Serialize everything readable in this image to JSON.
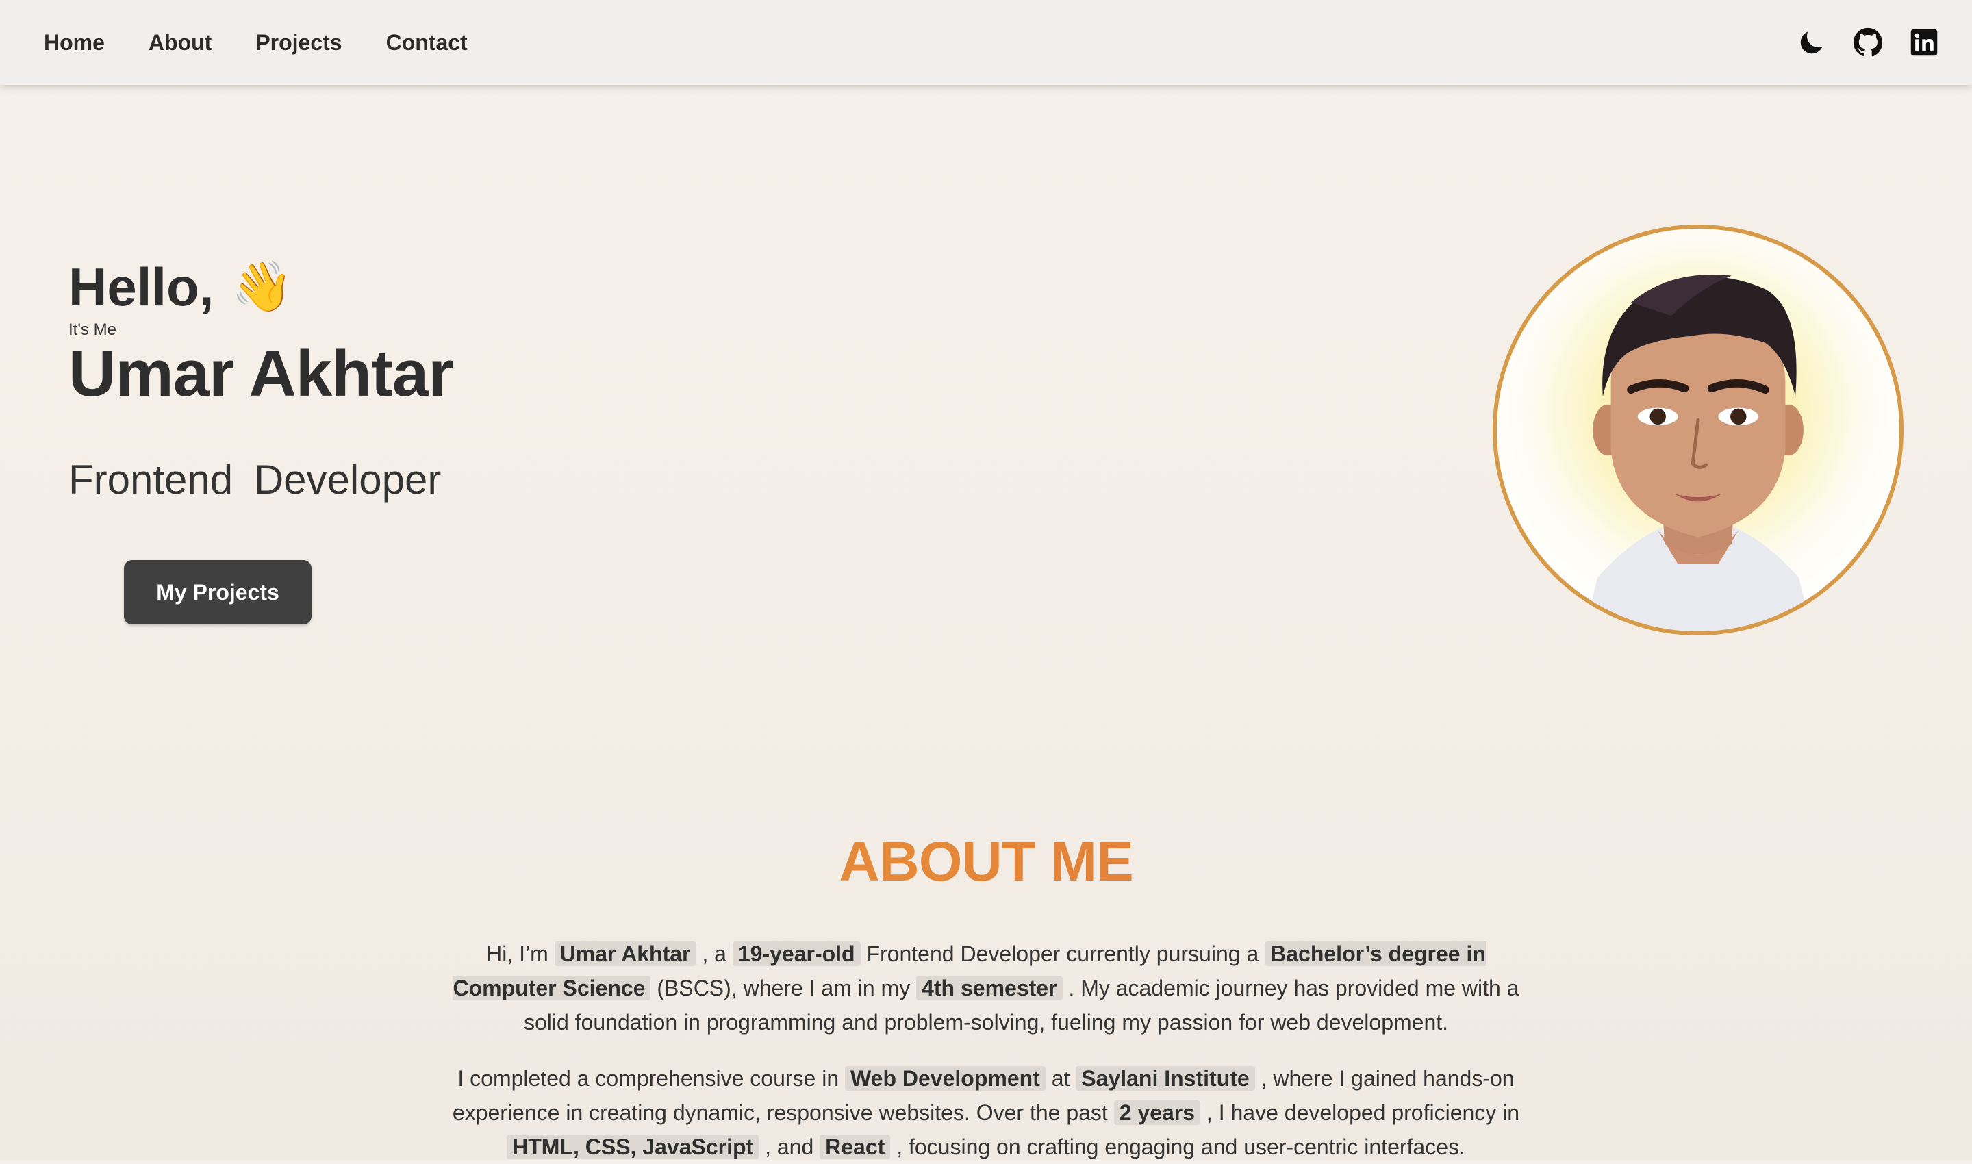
{
  "nav": {
    "links": [
      "Home",
      "About",
      "Projects",
      "Contact"
    ],
    "icons": [
      "moon-icon",
      "github-icon",
      "linkedin-icon"
    ]
  },
  "hero": {
    "greeting": "Hello,",
    "wave": "👋",
    "intro": "It's Me",
    "name": "Umar Akhtar",
    "role": "Frontend Developer",
    "button": "My Projects"
  },
  "about": {
    "title": "ABOUT ME",
    "p1": {
      "t1": "Hi, I’m ",
      "h1": "Umar Akhtar",
      "t2": " , a ",
      "h2": "19-year-old",
      "t3": "  Frontend Developer currently pursuing a ",
      "h3": "Bachelor’s degree in Computer Science",
      "t4": "  (BSCS), where I am in my ",
      "h4": "4th semester",
      "t5": " . My academic journey has provided me with a solid foundation in programming and problem-solving, fueling my passion for web development."
    },
    "p2": {
      "t1": "I completed a comprehensive course in ",
      "h1": "Web Development",
      "t2": "  at ",
      "h2": "Saylani Institute",
      "t3": " , where I gained hands-on experience in creating dynamic, responsive websites. Over the past ",
      "h3": "2 years",
      "t4": " , I have developed proficiency in ",
      "h4": "HTML, CSS, JavaScript",
      "t5": " , and ",
      "h5": "React",
      "t6": " , focusing on crafting engaging and user-centric interfaces."
    }
  },
  "colors": {
    "accent_start": "#e9a33a",
    "accent_end": "#e06a3a",
    "avatar_border": "#d79a48",
    "button_bg": "#404040",
    "highlight_bg": "#ddd8d2"
  }
}
